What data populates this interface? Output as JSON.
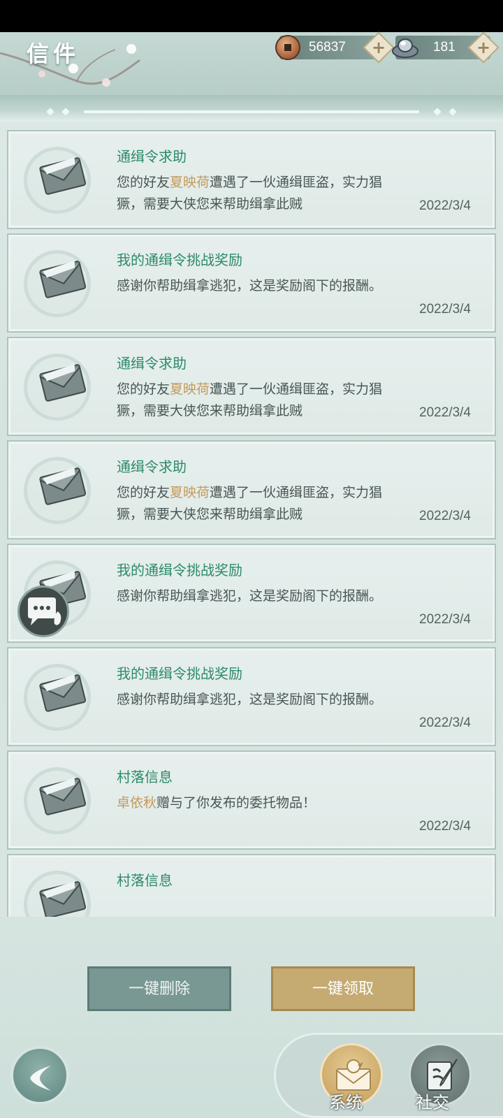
{
  "header": {
    "title": "信件",
    "copper": "56837",
    "ingot": "181"
  },
  "mails": [
    {
      "title": "通缉令求助",
      "pre": "您的好友",
      "name": "夏映荷",
      "post": "遭遇了一伙通缉匪盗，实力猖獗，需要大侠您来帮助缉拿此贼",
      "date": "2022/3/4"
    },
    {
      "title": "我的通缉令挑战奖励",
      "pre": "感谢你帮助缉拿逃犯，这是奖励阁下的报酬。",
      "name": "",
      "post": "",
      "date": "2022/3/4"
    },
    {
      "title": "通缉令求助",
      "pre": "您的好友",
      "name": "夏映荷",
      "post": "遭遇了一伙通缉匪盗，实力猖獗，需要大侠您来帮助缉拿此贼",
      "date": "2022/3/4"
    },
    {
      "title": "通缉令求助",
      "pre": "您的好友",
      "name": "夏映荷",
      "post": "遭遇了一伙通缉匪盗，实力猖獗，需要大侠您来帮助缉拿此贼",
      "date": "2022/3/4"
    },
    {
      "title": "我的通缉令挑战奖励",
      "pre": "感谢你帮助缉拿逃犯，这是奖励阁下的报酬。",
      "name": "",
      "post": "",
      "date": "2022/3/4"
    },
    {
      "title": "我的通缉令挑战奖励",
      "pre": "感谢你帮助缉拿逃犯，这是奖励阁下的报酬。",
      "name": "",
      "post": "",
      "date": "2022/3/4"
    },
    {
      "title": "村落信息",
      "pre": "",
      "name": "卓依秋",
      "post": "赠与了你发布的委托物品！",
      "date": "2022/3/4"
    },
    {
      "title": "村落信息",
      "pre": "",
      "name": "",
      "post": "",
      "date": ""
    }
  ],
  "actions": {
    "delete_all": "一键删除",
    "claim_all": "一键领取"
  },
  "tabs": {
    "system": "系统",
    "social": "社交"
  },
  "colors": {
    "title_green": "#2c8a6a",
    "name_highlight": "#c49a5c",
    "claim_gold": "#c5ab72",
    "delete_teal": "#7a9893"
  }
}
